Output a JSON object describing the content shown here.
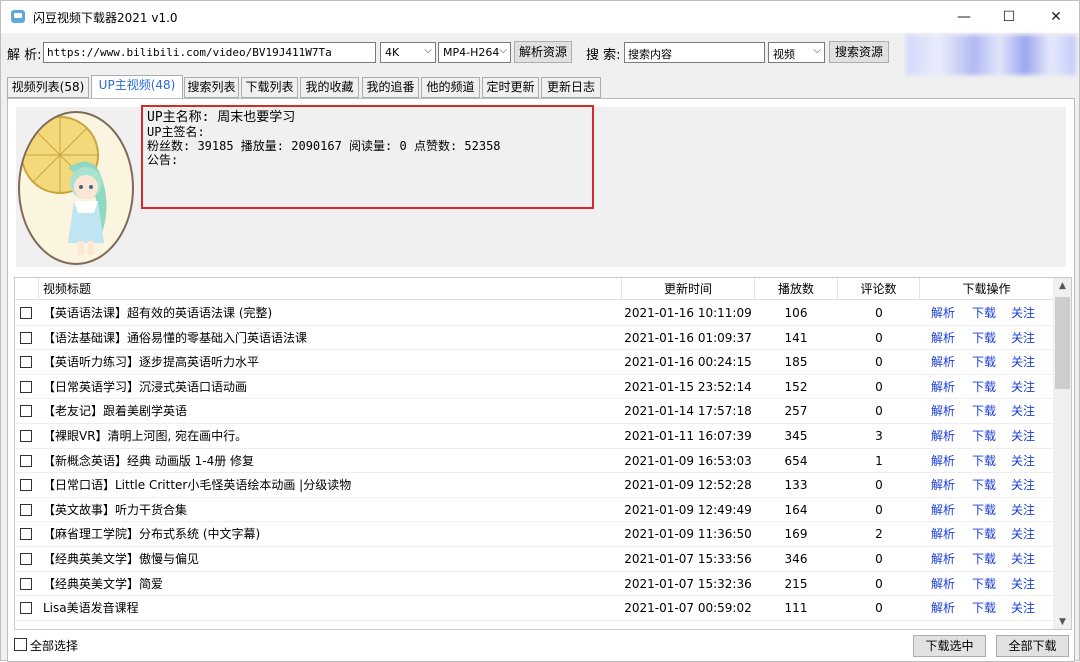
{
  "window": {
    "title": "闪豆视频下载器2021 v1.0",
    "minimize": "—",
    "maximize": "☐",
    "close": "✕"
  },
  "urlbar": {
    "parse_label": "解 析:",
    "url_value": "https://www.bilibili.com/video/BV19J411W7Ta",
    "quality": "4K",
    "format": "MP4-H264",
    "parse_button": "解析资源",
    "search_label": "搜 索:",
    "search_value": "搜索内容",
    "search_type": "视频",
    "search_button": "搜索资源"
  },
  "tabs": [
    {
      "label": "视频列表(58)"
    },
    {
      "label": "UP主视频(48)",
      "active": true
    },
    {
      "label": "搜索列表"
    },
    {
      "label": "下载列表"
    },
    {
      "label": "我的收藏"
    },
    {
      "label": "我的追番"
    },
    {
      "label": "他的频道"
    },
    {
      "label": "定时更新"
    },
    {
      "label": "更新日志"
    }
  ],
  "up_info": {
    "name_line": "UP主名称: 周末也要学习",
    "sign_line": "UP主签名:",
    "stats_line": "粉丝数: 39185  播放量: 2090167  阅读量: 0  点赞数: 52358",
    "notice_line": "公告:"
  },
  "table": {
    "headers": {
      "title": "视频标题",
      "time": "更新时间",
      "plays": "播放数",
      "comments": "评论数",
      "actions": "下载操作"
    },
    "actions": {
      "parse": "解析",
      "download": "下载",
      "follow": "关注"
    },
    "rows": [
      {
        "title": "【英语语法课】超有效的英语语法课 (完整)",
        "time": "2021-01-16 10:11:09",
        "plays": "106",
        "comments": "0"
      },
      {
        "title": "【语法基础课】通俗易懂的零基础入门英语语法课",
        "time": "2021-01-16 01:09:37",
        "plays": "141",
        "comments": "0"
      },
      {
        "title": "【英语听力练习】逐步提高英语听力水平",
        "time": "2021-01-16 00:24:15",
        "plays": "185",
        "comments": "0"
      },
      {
        "title": "【日常英语学习】沉浸式英语口语动画",
        "time": "2021-01-15 23:52:14",
        "plays": "152",
        "comments": "0"
      },
      {
        "title": "【老友记】跟着美剧学英语",
        "time": "2021-01-14 17:57:18",
        "plays": "257",
        "comments": "0"
      },
      {
        "title": "【裸眼VR】清明上河图, 宛在画中行。",
        "time": "2021-01-11 16:07:39",
        "plays": "345",
        "comments": "3"
      },
      {
        "title": "【新概念英语】经典 动画版 1-4册 修复",
        "time": "2021-01-09 16:53:03",
        "plays": "654",
        "comments": "1"
      },
      {
        "title": "【日常口语】Little Critter小毛怪英语绘本动画 |分级读物",
        "time": "2021-01-09 12:52:28",
        "plays": "133",
        "comments": "0"
      },
      {
        "title": "【英文故事】听力干货合集",
        "time": "2021-01-09 12:49:49",
        "plays": "164",
        "comments": "0"
      },
      {
        "title": "【麻省理工学院】分布式系统 (中文字幕)",
        "time": "2021-01-09 11:36:50",
        "plays": "169",
        "comments": "2"
      },
      {
        "title": "【经典英美文学】傲慢与偏见",
        "time": "2021-01-07 15:33:56",
        "plays": "346",
        "comments": "0"
      },
      {
        "title": "【经典英美文学】简爱",
        "time": "2021-01-07 15:32:36",
        "plays": "215",
        "comments": "0"
      },
      {
        "title": "Lisa美语发音课程",
        "time": "2021-01-07 00:59:02",
        "plays": "111",
        "comments": "0"
      }
    ]
  },
  "bottom": {
    "select_all": "全部选择",
    "download_selected": "下载选中",
    "download_all": "全部下载"
  },
  "colors": {
    "accent_blue": "#2c6bd6",
    "link_blue": "#1a3cd8",
    "highlight_red": "#d82a2a"
  }
}
